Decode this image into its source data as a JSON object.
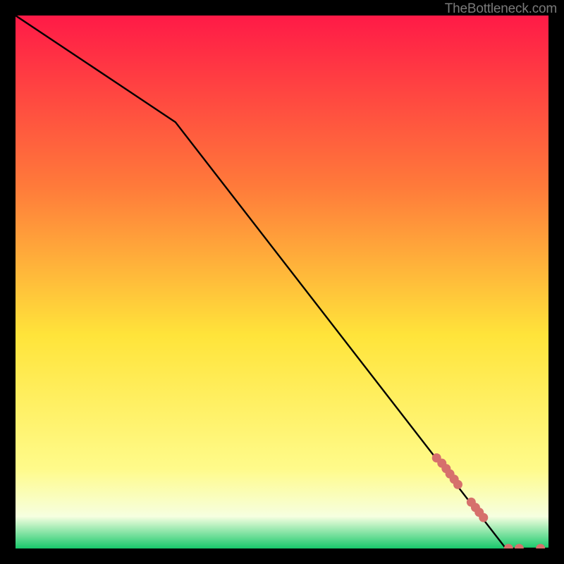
{
  "attribution": "TheBottleneck.com",
  "colors": {
    "gradient_top": "#ff1a47",
    "gradient_mid_upper": "#ff7a3a",
    "gradient_mid": "#ffe43a",
    "gradient_lower": "#fffb8a",
    "gradient_lowest": "#f6ffe0",
    "gradient_bottom": "#18c96b",
    "line": "#000000",
    "marker": "#d6706c",
    "frame": "#000000"
  },
  "chart_data": {
    "type": "line",
    "title": "",
    "xlabel": "",
    "ylabel": "",
    "xlim": [
      0,
      100
    ],
    "ylim": [
      0,
      100
    ],
    "grid": false,
    "legend": false,
    "series": [
      {
        "name": "bottleneck-curve",
        "x": [
          0,
          30,
          92,
          100
        ],
        "y": [
          100,
          80,
          0,
          0
        ]
      }
    ],
    "markers": [
      {
        "name": "highlight-points",
        "points": [
          {
            "x": 79,
            "y": 17
          },
          {
            "x": 80,
            "y": 16
          },
          {
            "x": 80.8,
            "y": 15
          },
          {
            "x": 81.5,
            "y": 14
          },
          {
            "x": 82.3,
            "y": 13
          },
          {
            "x": 83,
            "y": 12
          },
          {
            "x": 85.5,
            "y": 8.7
          },
          {
            "x": 86.3,
            "y": 7.7
          },
          {
            "x": 87,
            "y": 6.8
          },
          {
            "x": 87.8,
            "y": 5.8
          },
          {
            "x": 92.5,
            "y": 0
          },
          {
            "x": 94.5,
            "y": 0
          },
          {
            "x": 98.5,
            "y": 0
          }
        ]
      }
    ]
  }
}
